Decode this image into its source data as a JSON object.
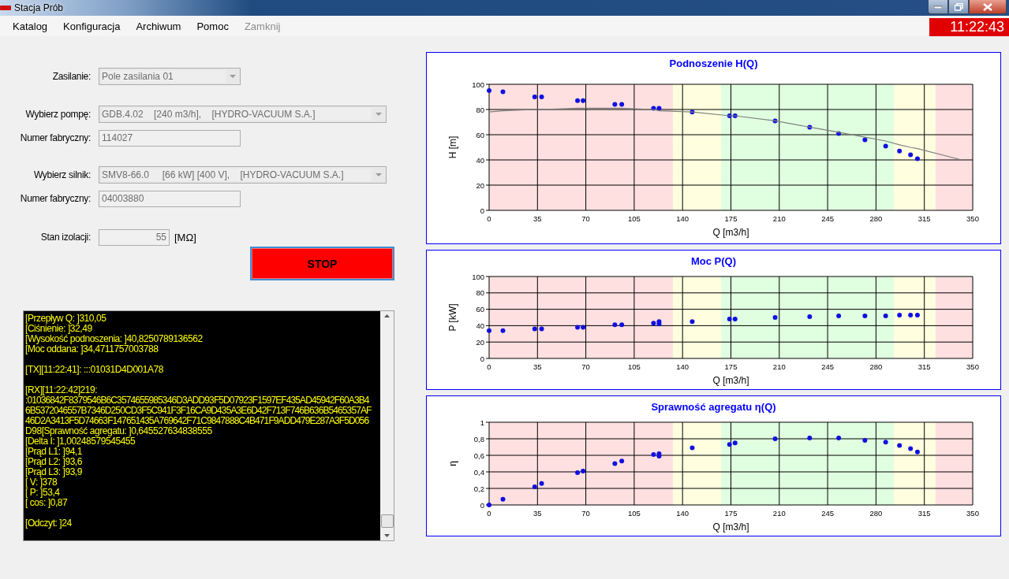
{
  "window": {
    "title": "Stacja Prób"
  },
  "menu": [
    {
      "label": "Katalog",
      "disabled": false
    },
    {
      "label": "Konfiguracja",
      "disabled": false
    },
    {
      "label": "Archiwum",
      "disabled": false
    },
    {
      "label": "Pomoc",
      "disabled": false
    },
    {
      "label": "Zamknij",
      "disabled": true
    }
  ],
  "clock": "11:22:43",
  "form": {
    "power_supply": {
      "label": "Zasilanie:",
      "value": "Pole zasilania 01"
    },
    "pump": {
      "label": "Wybierz pompę:",
      "value": "GDB.4.02    [240 m3/h],    [HYDRO-VACUUM S.A.]",
      "serial_label": "Numer fabryczny:",
      "serial": "114027"
    },
    "motor": {
      "label": "Wybierz silnik:",
      "value": "SMV8-66.0     [66 kW] [400 V],    [HYDRO-VACUUM S.A.]",
      "serial_label": "Numer fabryczny:",
      "serial": "04003880"
    },
    "insulation": {
      "label": "Stan izolacji:",
      "value": "55",
      "unit": "[MΩ]"
    }
  },
  "stop_button": "STOP",
  "log": [
    [
      "[Przepływ Q: ]310,05",
      "[Ciśnienie: ]32,49",
      "[Wysokość podnoszenia: ]40,8250789136562",
      "[Moc oddana: ]34,4711757003788"
    ],
    [
      "[TX][11:22:41]: :::01031D4D001A78"
    ],
    [
      "[RX][11:22:42]219:",
      ":01036842F8379546B6C3574655985346D3ADD93F5D07923F1597EF435AD45942F60A3B4",
      "6B5372046557B7346D250CD3F5C941F3F16CA9D435A3E6D42F713F746B636B5465357AF",
      "46D2A3413F5D74663F147651435A769642F71C9847888C4B471F9ADD479E287A3F5D056",
      "D98[Sprawność agregatu: ]0,645527634838555",
      "[Delta I: ]1,00248579545455",
      "[Prąd L1: ]94,1",
      "[Prąd L2: ]93,6",
      "[Prąd L3: ]93,9",
      "[ V: ]378",
      "[ P: ]53,4",
      "[ cos: ]0,87"
    ],
    [
      "[Odczyt: ]24"
    ]
  ],
  "charts": [
    {
      "chart_data": {
        "type": "scatter",
        "title": "Podnoszenie H(Q)",
        "xlabel": "Q [m3/h]",
        "ylabel": "H [m]",
        "grid": true,
        "x": [
          0,
          10,
          33,
          38,
          64,
          68,
          91,
          96,
          119,
          123,
          123,
          147,
          174,
          178,
          207,
          232,
          253,
          272,
          287,
          297,
          305,
          310,
          342
        ],
        "series": [
          {
            "type": "scatter",
            "color": "#1010e0",
            "values": [
              95,
              94,
              90,
              90,
              87,
              87,
              84,
              84,
              81,
              81,
              null,
              78,
              75,
              75,
              71,
              66,
              61,
              56,
              51,
              47,
              44,
              41,
              null
            ]
          },
          {
            "type": "line",
            "color": "#808080",
            "values": [
              78,
              79,
              80,
              80,
              81,
              81,
              81,
              81,
              80,
              79,
              79,
              78,
              75,
              75,
              71,
              66,
              62,
              58,
              55,
              52,
              50,
              49,
              40
            ]
          }
        ],
        "xlim": [
          0,
          350
        ],
        "ylim": [
          0,
          100
        ],
        "xticks": [
          0,
          35,
          70,
          105,
          140,
          175,
          210,
          245,
          280,
          315,
          350
        ],
        "yticks": [
          0,
          20,
          40,
          60,
          80,
          100
        ],
        "bands": [
          {
            "axis": "x",
            "from": 0,
            "to": 133,
            "color": "#ffe0e0"
          },
          {
            "axis": "x",
            "from": 133,
            "to": 168,
            "color": "#ffffe0"
          },
          {
            "axis": "x",
            "from": 168,
            "to": 293,
            "color": "#e0ffe0"
          },
          {
            "axis": "x",
            "from": 293,
            "to": 323,
            "color": "#ffffe0"
          },
          {
            "axis": "x",
            "from": 323,
            "to": 350,
            "color": "#ffe0e0"
          }
        ]
      }
    },
    {
      "chart_data": {
        "type": "scatter",
        "title": "Moc P(Q)",
        "xlabel": "Q [m3/h]",
        "ylabel": "P [kW]",
        "grid": true,
        "x": [
          0,
          10,
          33,
          38,
          64,
          68,
          91,
          96,
          119,
          123,
          123,
          147,
          174,
          178,
          207,
          232,
          253,
          272,
          287,
          297,
          305,
          310
        ],
        "series": [
          {
            "type": "scatter",
            "color": "#1010e0",
            "values": [
              34,
              34,
              36,
              36,
              38,
              38,
              41,
              41,
              43,
              42,
              45,
              45,
              48,
              48,
              50,
              51,
              52,
              52,
              52,
              53,
              53,
              53
            ]
          }
        ],
        "xlim": [
          0,
          350
        ],
        "ylim": [
          0,
          100
        ],
        "xticks": [
          0,
          35,
          70,
          105,
          140,
          175,
          210,
          245,
          280,
          315,
          350
        ],
        "yticks": [
          0,
          20,
          40,
          60,
          80,
          100
        ],
        "bands": [
          {
            "axis": "x",
            "from": 0,
            "to": 133,
            "color": "#ffe0e0"
          },
          {
            "axis": "x",
            "from": 133,
            "to": 168,
            "color": "#ffffe0"
          },
          {
            "axis": "x",
            "from": 168,
            "to": 293,
            "color": "#e0ffe0"
          },
          {
            "axis": "x",
            "from": 293,
            "to": 323,
            "color": "#ffffe0"
          },
          {
            "axis": "x",
            "from": 323,
            "to": 350,
            "color": "#ffe0e0"
          }
        ]
      }
    },
    {
      "chart_data": {
        "type": "scatter",
        "title": "Sprawność agregatu η(Q)",
        "xlabel": "Q [m3/h]",
        "ylabel": "η",
        "grid": true,
        "x": [
          0,
          10,
          33,
          38,
          64,
          68,
          91,
          96,
          119,
          123,
          123,
          147,
          174,
          178,
          207,
          232,
          253,
          272,
          287,
          297,
          305,
          310
        ],
        "series": [
          {
            "type": "scatter",
            "color": "#1010e0",
            "values": [
              0,
              0.07,
              0.22,
              0.26,
              0.39,
              0.41,
              0.5,
              0.53,
              0.61,
              0.59,
              0.62,
              0.69,
              0.73,
              0.75,
              0.8,
              0.81,
              0.81,
              0.78,
              0.76,
              0.72,
              0.68,
              0.64
            ]
          }
        ],
        "xlim": [
          0,
          350
        ],
        "ylim": [
          0,
          1
        ],
        "xticks": [
          0,
          35,
          70,
          105,
          140,
          175,
          210,
          245,
          280,
          315,
          350
        ],
        "yticks": [
          {
            "value": 0,
            "label": "0"
          },
          {
            "value": 0.2,
            "label": "0,2"
          },
          {
            "value": 0.4,
            "label": "0,4"
          },
          {
            "value": 0.6,
            "label": "0,6"
          },
          {
            "value": 0.8,
            "label": "0,8"
          },
          {
            "value": 1,
            "label": "1"
          }
        ],
        "bands": [
          {
            "axis": "x",
            "from": 0,
            "to": 133,
            "color": "#ffe0e0"
          },
          {
            "axis": "x",
            "from": 133,
            "to": 168,
            "color": "#ffffe0"
          },
          {
            "axis": "x",
            "from": 168,
            "to": 293,
            "color": "#e0ffe0"
          },
          {
            "axis": "x",
            "from": 293,
            "to": 323,
            "color": "#ffffe0"
          },
          {
            "axis": "x",
            "from": 323,
            "to": 350,
            "color": "#ffe0e0"
          }
        ]
      }
    }
  ]
}
